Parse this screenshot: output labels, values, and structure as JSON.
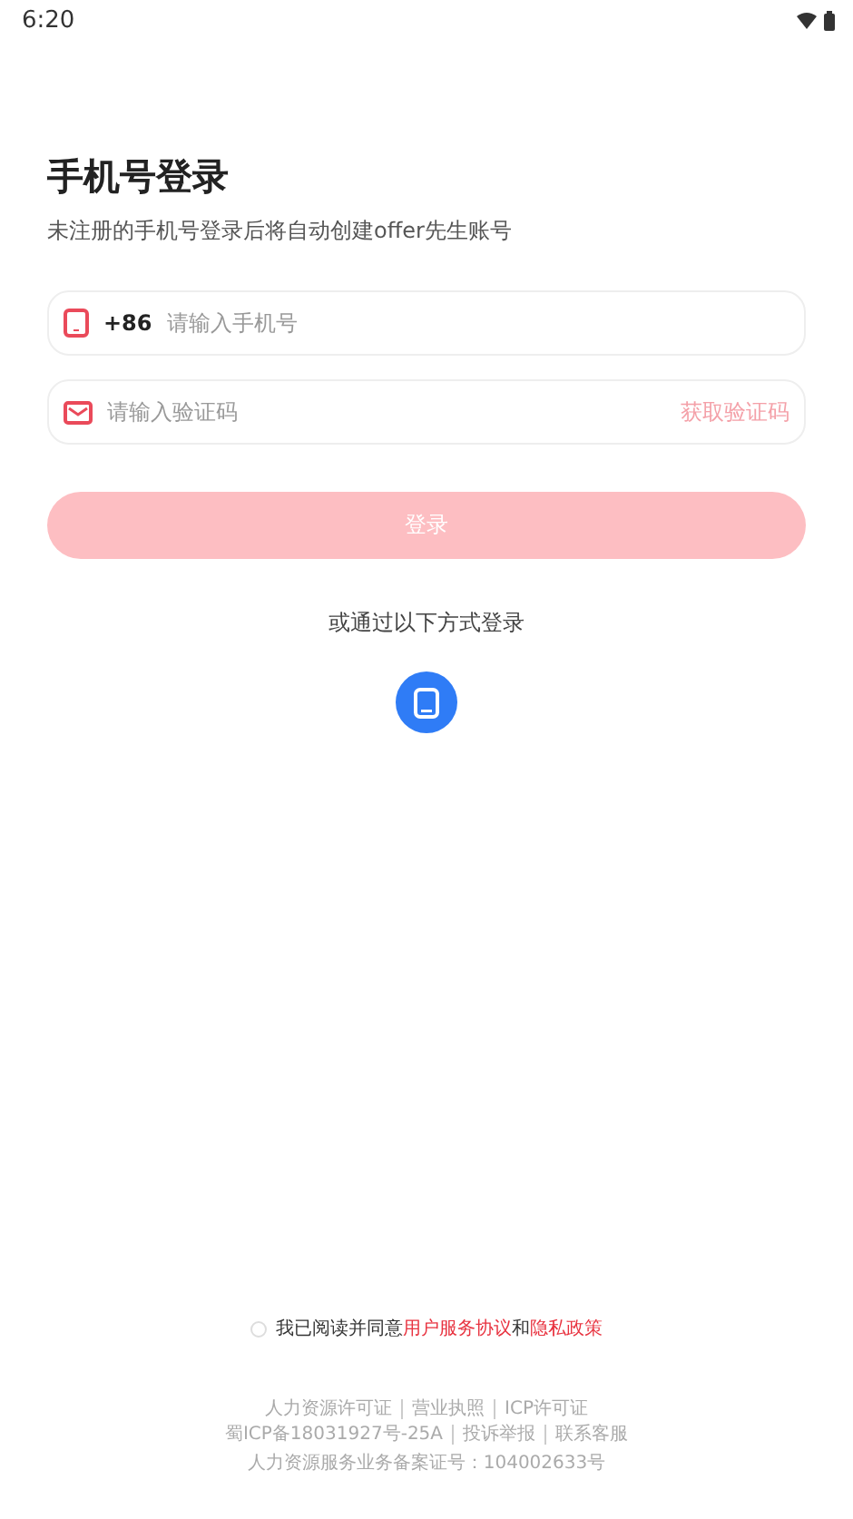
{
  "status_bar": {
    "time": "6:20"
  },
  "title": "手机号登录",
  "subtitle": "未注册的手机号登录后将自动创建offer先生账号",
  "phone_field": {
    "country_code": "+86",
    "placeholder": "请输入手机号"
  },
  "code_field": {
    "placeholder": "请输入验证码",
    "action": "获取验证码"
  },
  "login_button": {
    "label": "登录",
    "disabled": true
  },
  "alt_login": {
    "label": "或通过以下方式登录"
  },
  "agreement": {
    "checked": false,
    "text": "我已阅读并同意",
    "link_1": "用户服务协议",
    "joiner": "和",
    "link_2": "隐私政策"
  },
  "footer": {
    "lines": [
      [
        "人力资源许可证",
        "营业执照",
        "ICP许可证"
      ],
      [
        "蜀ICP备18031927号-25A",
        "投诉举报",
        "联系客服"
      ]
    ],
    "record": "人力资源服务业务备案证号：104002633号"
  }
}
